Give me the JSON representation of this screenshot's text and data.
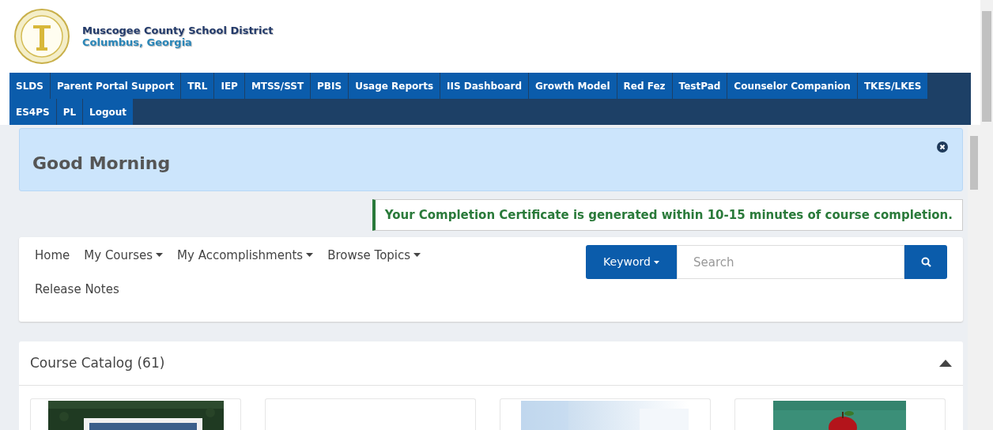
{
  "header": {
    "district": "Muscogee County School District",
    "city": "Columbus, Georgia"
  },
  "nav": {
    "links": [
      "SLDS",
      "Parent Portal Support",
      "TRL",
      "IEP",
      "MTSS/SST",
      "PBIS",
      "Usage Reports",
      "IIS Dashboard",
      "Growth Model",
      "Red Fez",
      "TestPad",
      "Counselor Companion",
      "TKES/LKES",
      "ES4PS",
      "PL",
      "Logout"
    ]
  },
  "greeting": {
    "title": "Good Morning"
  },
  "notice": "Your Completion Certificate is generated within 10-15 minutes of course completion.",
  "menu": {
    "items": [
      {
        "label": "Home",
        "dropdown": false
      },
      {
        "label": "My Courses",
        "dropdown": true
      },
      {
        "label": "My Accomplishments",
        "dropdown": true
      },
      {
        "label": "Browse Topics",
        "dropdown": true
      },
      {
        "label": "Release Notes",
        "dropdown": false
      }
    ],
    "search": {
      "mode": "Keyword",
      "placeholder": "Search"
    }
  },
  "catalog": {
    "title": "Course Catalog (61)",
    "expanded": true,
    "cards": [
      {
        "kind": "pattern"
      },
      {
        "kind": "blank"
      },
      {
        "kind": "gradient"
      },
      {
        "kind": "apple"
      }
    ]
  }
}
